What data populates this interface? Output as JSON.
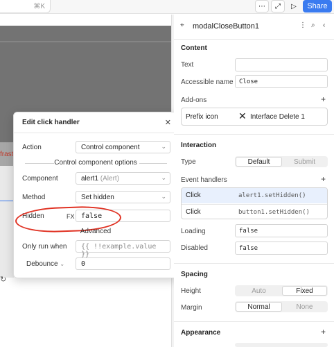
{
  "topbar": {
    "shortcut": "⌘K",
    "share_label": "Share"
  },
  "canvas": {
    "red_text": "frast"
  },
  "modal": {
    "title": "Edit click handler",
    "action_label": "Action",
    "action_value": "Control component",
    "section_options": "Control component options",
    "component_label": "Component",
    "component_value": "alert1",
    "component_type": "(Alert)",
    "method_label": "Method",
    "method_value": "Set hidden",
    "hidden_label": "Hidden",
    "hidden_fx": "FX",
    "hidden_value": "false",
    "section_advanced": "Advanced",
    "only_run_label": "Only run when",
    "only_run_placeholder": "{{ !!example.value }}",
    "debounce_label": "Debounce",
    "debounce_value": "0"
  },
  "inspector": {
    "component_name": "modalCloseButton1",
    "content": {
      "heading": "Content",
      "text_label": "Text",
      "text_value": "",
      "accessible_label": "Accessible name",
      "accessible_value": "Close",
      "addons_label": "Add-ons",
      "prefix_label": "Prefix icon",
      "prefix_value": "Interface Delete 1"
    },
    "interaction": {
      "heading": "Interaction",
      "type_label": "Type",
      "type_options": [
        "Default",
        "Submit"
      ],
      "event_handlers_label": "Event handlers",
      "handlers": [
        {
          "event": "Click",
          "action": "alert1.setHidden()"
        },
        {
          "event": "Click",
          "action": "button1.setHidden()"
        }
      ],
      "loading_label": "Loading",
      "loading_value": "false",
      "disabled_label": "Disabled",
      "disabled_value": "false"
    },
    "spacing": {
      "heading": "Spacing",
      "height_label": "Height",
      "height_options": [
        "Auto",
        "Fixed"
      ],
      "margin_label": "Margin",
      "margin_options": [
        "Normal",
        "None"
      ]
    },
    "appearance": {
      "heading": "Appearance"
    }
  },
  "colors": {
    "accent": "#3a7bf0",
    "annotation_red": "#e03122",
    "handler_highlight": "#e8f0fd"
  }
}
